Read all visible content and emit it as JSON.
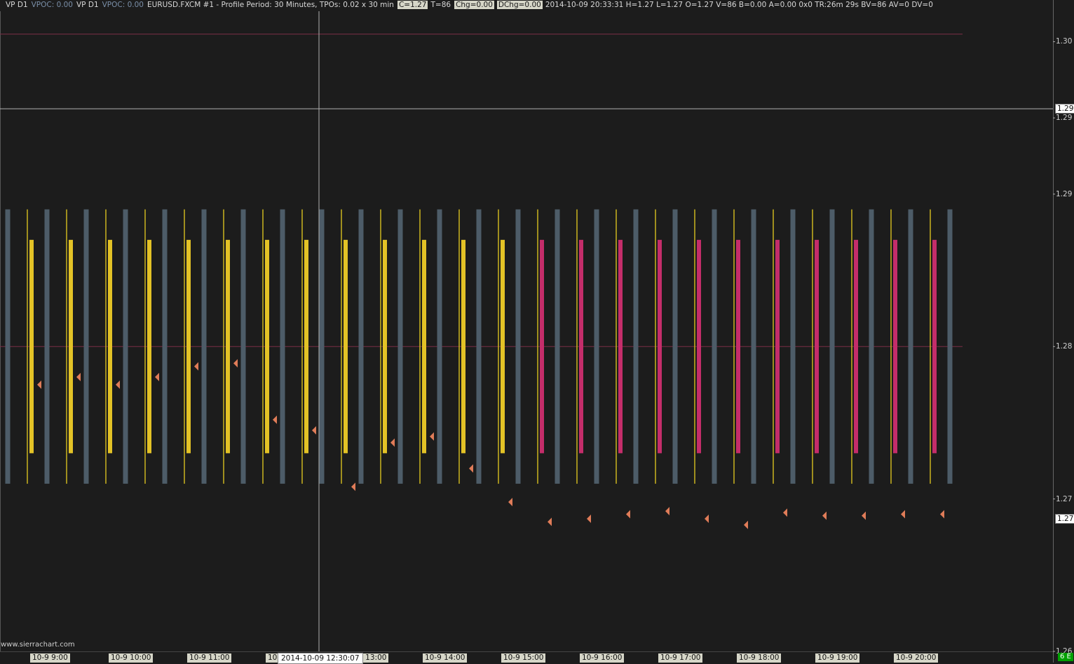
{
  "header": {
    "items": [
      {
        "text": "VP D1",
        "style": "study"
      },
      {
        "text": "VPOC: 0.00",
        "style": "vpoc"
      },
      {
        "text": "VP D1",
        "style": "study"
      },
      {
        "text": "VPOC: 0.00",
        "style": "vpoc"
      },
      {
        "text": "EURUSD.FXCM  #1 - Profile Period: 30 Minutes, TPOs: 0.02 x 30 min",
        "style": "study"
      },
      {
        "text": "C=1.27",
        "style": "boxed"
      },
      {
        "text": "T=86",
        "style": "study"
      },
      {
        "text": "Chg=0.00",
        "style": "boxed"
      },
      {
        "text": "DChg=0.00",
        "style": "boxed"
      },
      {
        "text": "2014-10-09  20:33:31 H=1.27 L=1.27 O=1.27 V=86 B=0.00 A=0.00 0x0 TR:26m 29s BV=86 AV=0 DV=0",
        "style": "study"
      }
    ]
  },
  "watermark": "www.sierrachart.com",
  "corner_badge": "6 E",
  "crosshair": {
    "time_label": "2014-10-09   12:30:07",
    "price_label": "1.29",
    "time_x": 12.5
  },
  "last_price_label": "1.27",
  "colors": {
    "background": "#1c1c1c",
    "gray_bar": "#4d5c68",
    "yellow_bar": "#e3c226",
    "magenta_bar": "#c42d6a",
    "thin_line": "#d8c020",
    "marker": "#e07c58",
    "ref_line": "#7a2e46",
    "crosshair": "#b0b0b0",
    "x_label_bg": "#d6d6c8"
  },
  "chart_data": {
    "type": "tpo_profile",
    "symbol": "EURUSD.FXCM",
    "y_ticks": [
      "1.30",
      "1.29",
      "1.29",
      "1.28",
      "1.27",
      "1.26"
    ],
    "y_tick_values": [
      1.2975,
      1.2925,
      1.2875,
      1.2775,
      1.2675,
      1.2575
    ],
    "ylim": [
      1.2575,
      1.2995
    ],
    "reference_lines": [
      1.298,
      1.2775
    ],
    "x_ticks": [
      {
        "label": "10-9  9:00",
        "t": 9.0
      },
      {
        "label": "10-9  10:00",
        "t": 10.0
      },
      {
        "label": "10-9  11:00",
        "t": 11.0
      },
      {
        "label": "10-9  12:00",
        "t": 12.0
      },
      {
        "label": "10-9  13:00",
        "t": 13.0
      },
      {
        "label": "10-9  14:00",
        "t": 14.0
      },
      {
        "label": "10-9  15:00",
        "t": 15.0
      },
      {
        "label": "10-9  16:00",
        "t": 16.0
      },
      {
        "label": "10-9  17:00",
        "t": 17.0
      },
      {
        "label": "10-9  18:00",
        "t": 18.0
      },
      {
        "label": "10-9  19:00",
        "t": 19.0
      },
      {
        "label": "10-9  20:00",
        "t": 20.0
      }
    ],
    "tpo_high": 1.2865,
    "tpo_low": 1.2685,
    "value_area_high": 1.2845,
    "value_area_low": 1.2705,
    "periods": [
      {
        "t": 8.5,
        "color": "none",
        "marker": null
      },
      {
        "t": 9.0,
        "color": "yellow",
        "marker": 1.275
      },
      {
        "t": 9.5,
        "color": "yellow",
        "marker": 1.2755
      },
      {
        "t": 10.0,
        "color": "yellow",
        "marker": 1.275
      },
      {
        "t": 10.5,
        "color": "yellow",
        "marker": 1.2755
      },
      {
        "t": 11.0,
        "color": "yellow",
        "marker": 1.2762
      },
      {
        "t": 11.5,
        "color": "yellow",
        "marker": 1.2764
      },
      {
        "t": 12.0,
        "color": "yellow",
        "marker": 1.2727
      },
      {
        "t": 12.5,
        "color": "yellow",
        "marker": 1.272
      },
      {
        "t": 13.0,
        "color": "yellow",
        "marker": 1.2683
      },
      {
        "t": 13.5,
        "color": "yellow",
        "marker": 1.2712
      },
      {
        "t": 14.0,
        "color": "yellow",
        "marker": 1.2716
      },
      {
        "t": 14.5,
        "color": "yellow",
        "marker": 1.2695
      },
      {
        "t": 15.0,
        "color": "yellow",
        "marker": 1.2673
      },
      {
        "t": 15.5,
        "color": "magenta",
        "marker": 1.266
      },
      {
        "t": 16.0,
        "color": "magenta",
        "marker": 1.2662
      },
      {
        "t": 16.5,
        "color": "magenta",
        "marker": 1.2665
      },
      {
        "t": 17.0,
        "color": "magenta",
        "marker": 1.2667
      },
      {
        "t": 17.5,
        "color": "magenta",
        "marker": 1.2662
      },
      {
        "t": 18.0,
        "color": "magenta",
        "marker": 1.2658
      },
      {
        "t": 18.5,
        "color": "magenta",
        "marker": 1.2666
      },
      {
        "t": 19.0,
        "color": "magenta",
        "marker": 1.2664
      },
      {
        "t": 19.5,
        "color": "magenta",
        "marker": 1.2664
      },
      {
        "t": 20.0,
        "color": "magenta",
        "marker": 1.2665
      },
      {
        "t": 20.5,
        "color": "magenta",
        "marker": 1.2665
      }
    ],
    "last_price": 1.2662,
    "crosshair_price": 1.2931
  }
}
